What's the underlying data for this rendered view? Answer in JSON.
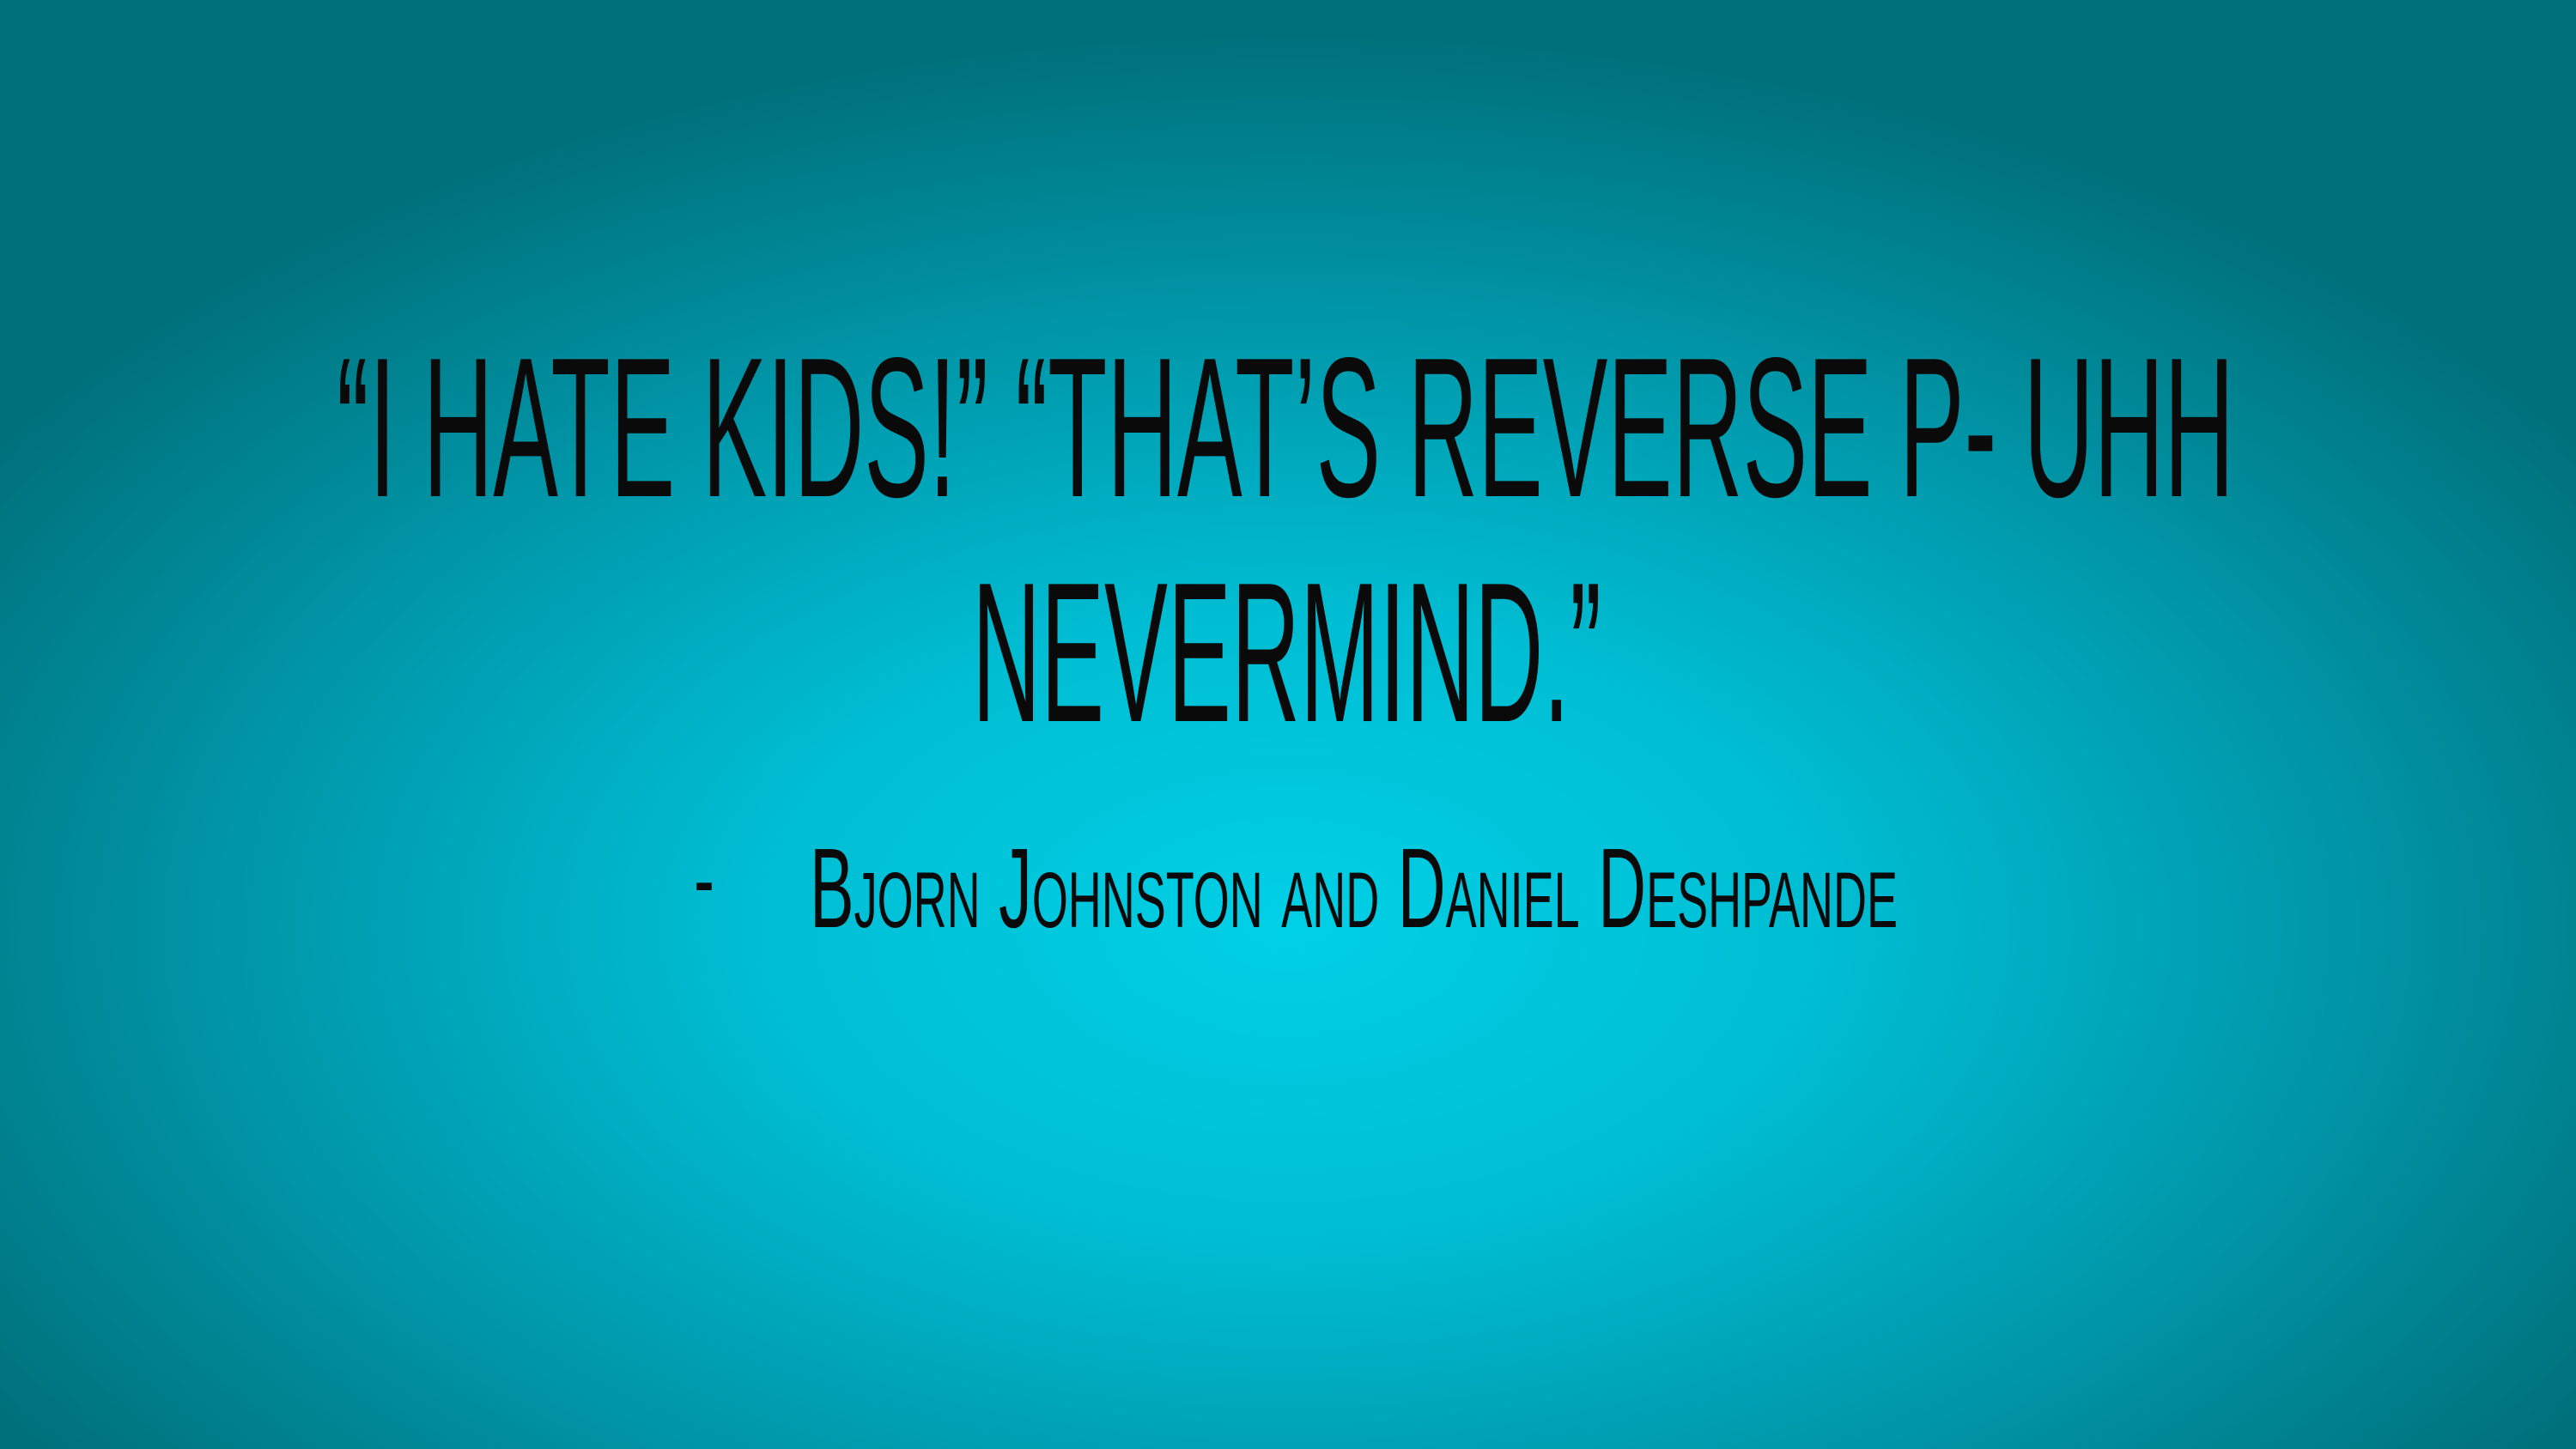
{
  "slide": {
    "quote_line_1": "“I HATE KIDS!”  “THAT’S REVERSE P- UHH",
    "quote_line_2": "NEVERMIND.”",
    "attribution_dash": "-",
    "attribution": "Bjorn Johnston and Daniel Deshpande"
  },
  "colors": {
    "background_center": "#00d0e6",
    "background_edge": "#00707a",
    "text": "#0a0a0a"
  }
}
